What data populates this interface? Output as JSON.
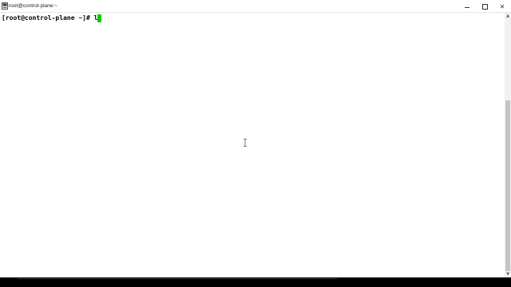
{
  "window": {
    "title": "root@control-plane:~",
    "icon": "terminal-app-icon",
    "controls": {
      "minimize_icon": "minimize-icon",
      "maximize_icon": "maximize-icon",
      "close_label": "✕"
    }
  },
  "terminal": {
    "prompt": "[root@control-plane ~]# ",
    "typed_input": "l",
    "cursor_color": "#00cc00",
    "background": "#ffffff",
    "foreground": "#000000"
  },
  "scrollbar": {
    "up_arrow": "▲",
    "down_arrow": "▼"
  }
}
